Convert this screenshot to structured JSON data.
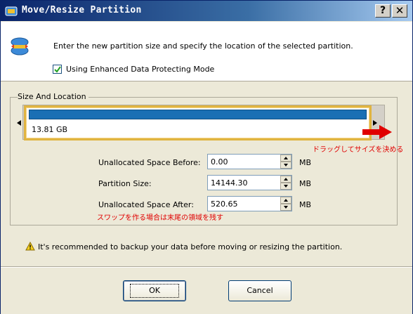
{
  "window": {
    "title": "Move/Resize Partition",
    "help_button": "?",
    "close_button": "✕"
  },
  "header": {
    "instruction": "Enter the new partition size and specify the location of the selected partition.",
    "checkbox_label": "Using Enhanced Data Protecting Mode",
    "checkbox_checked": true
  },
  "size_location": {
    "group_label": "Size And Location",
    "partition_size_text": "13.81 GB",
    "annotation_drag": "ドラッグしてサイズを決める",
    "annotation_swap": "スワップを作る場合は末尾の領域を残す",
    "fields": [
      {
        "label": "Unallocated Space Before:",
        "value": "0.00",
        "unit": "MB"
      },
      {
        "label": "Partition Size:",
        "value": "14144.30",
        "unit": "MB"
      },
      {
        "label": "Unallocated Space After:",
        "value": "520.65",
        "unit": "MB"
      }
    ]
  },
  "warning": {
    "text": "It's recommended to backup your data before moving or resizing the partition."
  },
  "buttons": {
    "ok_label": "OK",
    "cancel_label": "Cancel"
  },
  "colors": {
    "partition_bar": "#1a6fb4",
    "partition_border": "#e0b440",
    "annotation": "#e00000",
    "titlebar": "#0a246a"
  }
}
